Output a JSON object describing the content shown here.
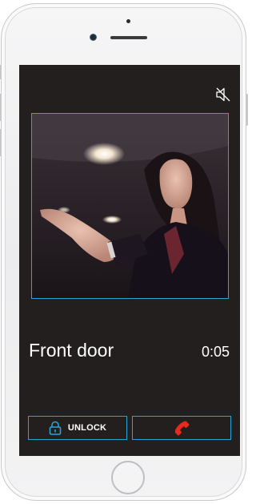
{
  "call": {
    "caller_name": "Front door",
    "duration": "0:05"
  },
  "actions": {
    "unlock_label": "UNLOCK"
  },
  "icons": {
    "mute": "speaker-muted-icon",
    "lock": "lock-icon",
    "hangup": "phone-hangup-icon"
  },
  "colors": {
    "screen_background": "#231f1f",
    "accent_border": "#2aa3d8",
    "hangup_red": "#e8291c",
    "text": "#ffffff"
  }
}
